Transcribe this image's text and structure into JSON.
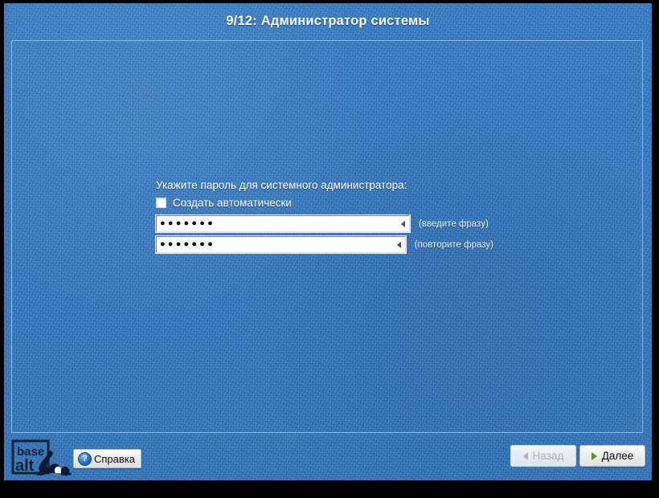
{
  "window": {
    "title": "9/12: Администратор системы"
  },
  "form": {
    "prompt": "Укажите пароль для системного администратора:",
    "auto_generate": {
      "label": "Создать автоматически",
      "checked": false
    },
    "fields": [
      {
        "name": "password",
        "value_mask": "●●●●●●●",
        "hint": "(введите фразу)"
      },
      {
        "name": "password_confirm",
        "value_mask": "●●●●●●●",
        "hint": "(повторите фразу)"
      }
    ]
  },
  "footer": {
    "logo": {
      "line1": "base",
      "line2": "alt"
    },
    "help_label": "Справка",
    "help_icon": "?",
    "back_label": "Назад",
    "next_label": "Далее"
  },
  "colors": {
    "background_blue": "#2d78c6",
    "panel_border": "#86b6e0",
    "next_arrow_green": "#4f9b2e",
    "help_icon_blue": "#1464b4",
    "disabled_text": "#a8b4c0"
  }
}
